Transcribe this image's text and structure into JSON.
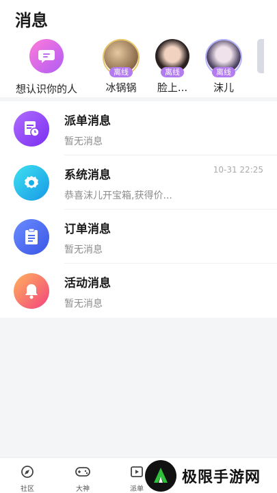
{
  "header": {
    "title": "消息"
  },
  "contacts": {
    "wish": {
      "label": "想认识你的人",
      "icon": "chat-bubble-icon"
    },
    "people": [
      {
        "name": "冰锅锅",
        "status": "离线"
      },
      {
        "name": "脸上...",
        "status": "离线"
      },
      {
        "name": "沫儿",
        "status": "离线"
      }
    ]
  },
  "messages": [
    {
      "title": "派单消息",
      "subtitle": "暂无消息",
      "time": "",
      "icon": "dispatch-document-icon",
      "color": "#8a3df5"
    },
    {
      "title": "系统消息",
      "subtitle": "恭喜沫儿开宝箱,获得价...",
      "time": "10-31 22:25",
      "icon": "gear-icon",
      "color": "#19c3e8"
    },
    {
      "title": "订单消息",
      "subtitle": "暂无消息",
      "time": "",
      "icon": "clipboard-icon",
      "color": "#4b6ff0"
    },
    {
      "title": "活动消息",
      "subtitle": "暂无消息",
      "time": "",
      "icon": "bell-icon",
      "color": "#f25a7a"
    }
  ],
  "tabbar": {
    "items": [
      {
        "label": "社区",
        "icon": "compass-icon"
      },
      {
        "label": "大神",
        "icon": "gamepad-icon"
      },
      {
        "label": "派单",
        "icon": "play-list-icon"
      }
    ]
  },
  "watermark": {
    "text": "极限手游网"
  }
}
